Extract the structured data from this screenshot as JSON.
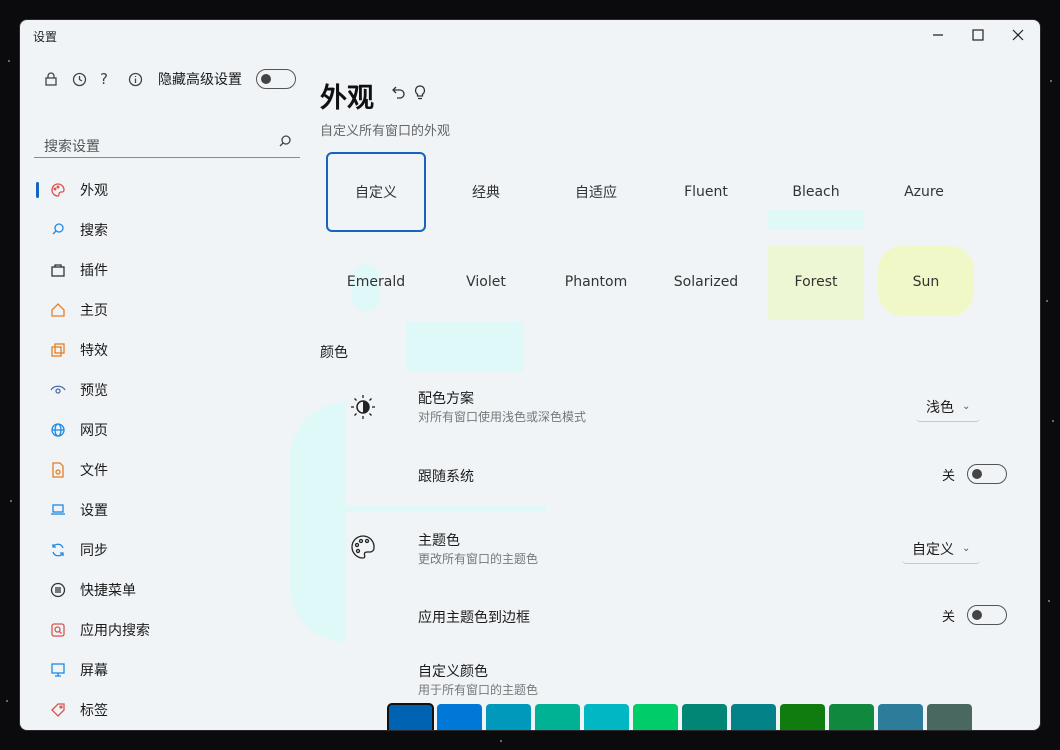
{
  "window": {
    "title": "设置"
  },
  "sidebar": {
    "hide_advanced_label": "隐藏高级设置",
    "search_placeholder": "搜索设置",
    "items": [
      {
        "label": "外观",
        "icon": "palette-icon",
        "color": "#d9534f"
      },
      {
        "label": "搜索",
        "icon": "search-icon",
        "color": "#1e88e5"
      },
      {
        "label": "插件",
        "icon": "bag-icon",
        "color": "#333333"
      },
      {
        "label": "主页",
        "icon": "home-icon",
        "color": "#e67e22"
      },
      {
        "label": "特效",
        "icon": "copy-icon",
        "color": "#e67e22"
      },
      {
        "label": "预览",
        "icon": "eye-icon",
        "color": "#4a6fa5"
      },
      {
        "label": "网页",
        "icon": "globe-icon",
        "color": "#1e88e5"
      },
      {
        "label": "文件",
        "icon": "file-icon",
        "color": "#e67e22"
      },
      {
        "label": "设置",
        "icon": "laptop-icon",
        "color": "#1e88e5"
      },
      {
        "label": "同步",
        "icon": "sync-icon",
        "color": "#1e88e5"
      },
      {
        "label": "快捷菜单",
        "icon": "menu-circle-icon",
        "color": "#333333"
      },
      {
        "label": "应用内搜索",
        "icon": "app-search-icon",
        "color": "#d9534f"
      },
      {
        "label": "屏幕",
        "icon": "monitor-icon",
        "color": "#1e88e5"
      },
      {
        "label": "标签",
        "icon": "tag-icon",
        "color": "#d9534f"
      }
    ]
  },
  "main": {
    "title": "外观",
    "subtitle": "自定义所有窗口的外观",
    "themes": [
      "自定义",
      "经典",
      "自适应",
      "Fluent",
      "Bleach",
      "Azure",
      "Emerald",
      "Violet",
      "Phantom",
      "Solarized",
      "Forest",
      "Sun"
    ],
    "section_color": "颜色",
    "color_scheme": {
      "title": "配色方案",
      "desc": "对所有窗口使用浅色或深色模式",
      "value": "浅色"
    },
    "follow_system": {
      "title": "跟随系统",
      "state": "关"
    },
    "theme_color": {
      "title": "主题色",
      "desc": "更改所有窗口的主题色",
      "value": "自定义"
    },
    "apply_border": {
      "title": "应用主题色到边框",
      "state": "关"
    },
    "custom_color": {
      "title": "自定义颜色",
      "desc": "用于所有窗口的主题色"
    },
    "swatches": [
      "#0063b1",
      "#0078d7",
      "#0099bc",
      "#00b294",
      "#00b7c3",
      "#00cc6a",
      "#018574",
      "#038387",
      "#107c10",
      "#10893e",
      "#2d7d9a",
      "#486860"
    ]
  }
}
